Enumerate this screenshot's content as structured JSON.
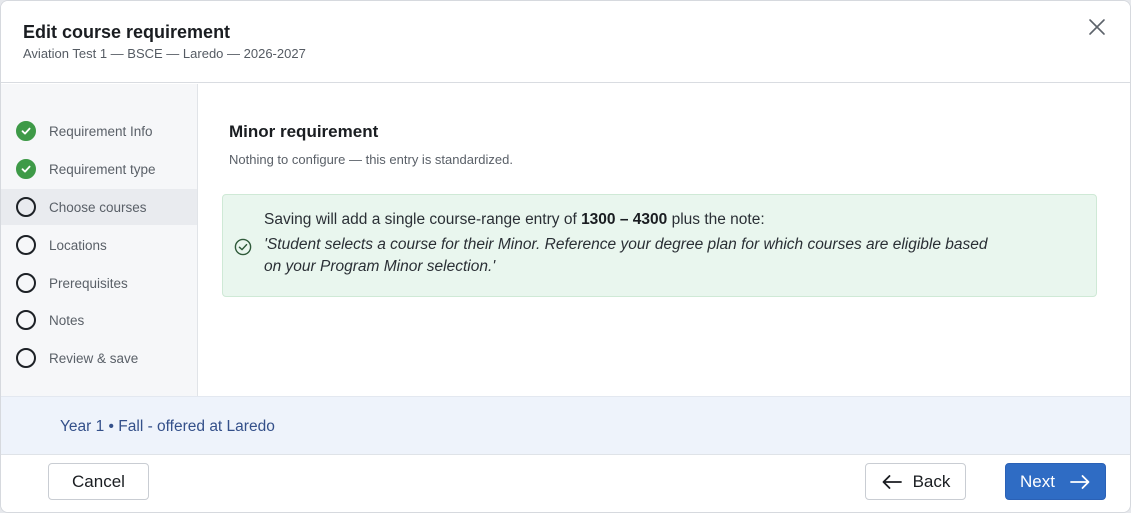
{
  "dialog": {
    "title": "Edit course requirement",
    "subtitle": "Aviation Test 1 — BSCE — Laredo — 2026-2027"
  },
  "steps": [
    {
      "label": "Requirement Info",
      "status": "done"
    },
    {
      "label": "Requirement type",
      "status": "done"
    },
    {
      "label": "Choose courses",
      "status": "current"
    },
    {
      "label": "Locations",
      "status": "todo"
    },
    {
      "label": "Prerequisites",
      "status": "todo"
    },
    {
      "label": "Notes",
      "status": "todo"
    },
    {
      "label": "Review & save",
      "status": "todo"
    }
  ],
  "main": {
    "heading": "Minor requirement",
    "description": "Nothing to configure — this entry is standardized.",
    "notice": {
      "prefix": "Saving will add a single course-range entry of ",
      "range": "1300 – 4300",
      "suffix": " plus the note:",
      "quote": "'Student selects a course for their Minor. Reference your degree plan for which courses are eligible based on your Program Minor selection.'"
    }
  },
  "footer_info": "Year 1 • Fall - offered at Laredo",
  "actions": {
    "cancel": "Cancel",
    "back": "Back",
    "next": "Next"
  },
  "colors": {
    "done": "#3e9a48",
    "primary": "#2f6cc4",
    "notice_bg": "#e9f6ee",
    "footer_bg": "#eef3fb"
  }
}
